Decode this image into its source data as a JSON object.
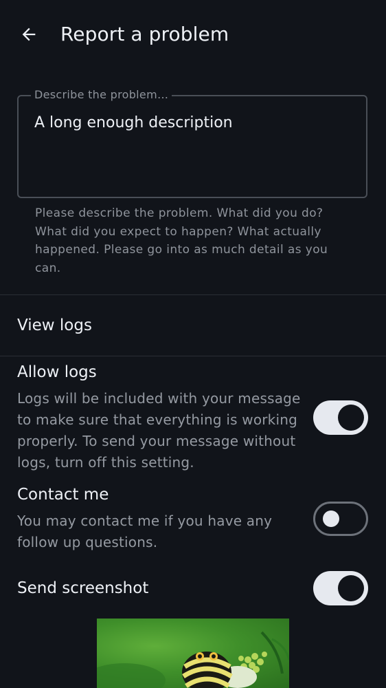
{
  "header": {
    "title": "Report a problem"
  },
  "description_field": {
    "label": "Describe the problem…",
    "value": "A long enough description",
    "helper_text": "Please describe the problem. What did you do? What did you expect to happen? What actually happened. Please go into as much detail as you can."
  },
  "view_logs": {
    "label": "View logs"
  },
  "settings": [
    {
      "title": "Allow logs",
      "description": "Logs will be included with your message to make sure that everything is working properly. To send your message without logs, turn off this setting.",
      "enabled": true
    },
    {
      "title": "Contact me",
      "description": "You may contact me if you have any follow up questions.",
      "enabled": false
    },
    {
      "title": "Send screenshot",
      "enabled": true
    }
  ],
  "colors": {
    "background": "#11141a",
    "text_primary": "#eef1f6",
    "text_secondary": "#8f949c",
    "switch_on_track": "#e6e9ef",
    "switch_off_outline": "#6d727a"
  },
  "icons": {
    "back": "arrow-back-icon"
  }
}
